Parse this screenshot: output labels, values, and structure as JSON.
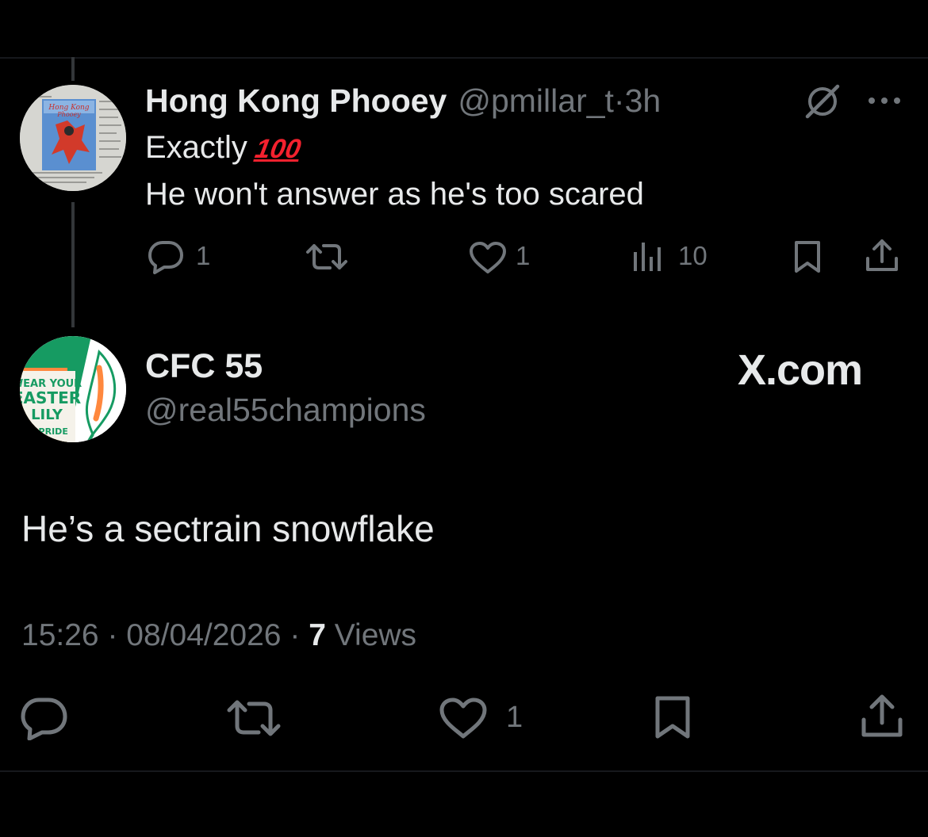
{
  "reply": {
    "display_name": "Hong Kong Phooey",
    "handle": "@pmillar_t",
    "separator": "·",
    "time": "3h",
    "text_line1": "Exactly",
    "emoji": "100",
    "text_line2": "He won't answer as he's too scared",
    "avatar_text_top": "Hong Kong",
    "avatar_text_bottom": "Phooey",
    "actions": {
      "replies": "1",
      "retweets": "",
      "likes": "1",
      "views": "10"
    },
    "icons": [
      "grok-icon",
      "more-icon",
      "reply-icon",
      "retweet-icon",
      "like-icon",
      "views-icon",
      "bookmark-icon",
      "share-icon"
    ]
  },
  "main": {
    "display_name": "CFC 55",
    "handle": "@real55champions",
    "watermark": "X.com",
    "text": "He’s a sectrain snowflake",
    "avatar_text": [
      "WEAR YOUR",
      "EASTER",
      "LILY",
      "'H PRIDE"
    ],
    "time": "15:26",
    "date": "08/04/2026",
    "views_count": "7",
    "views_label": "Views",
    "separator": "·",
    "actions": {
      "replies": "",
      "retweets": "",
      "likes": "1"
    },
    "icons": [
      "reply-icon",
      "retweet-icon",
      "like-icon",
      "bookmark-icon",
      "share-icon"
    ]
  },
  "colors": {
    "background": "#000000",
    "text_primary": "#e7e9ea",
    "text_secondary": "#71767b",
    "divider": "#16181c",
    "thread_line": "#333639",
    "emoji_red": "#f4212e",
    "lily_green": "#169b62",
    "lily_orange": "#ff883e"
  }
}
